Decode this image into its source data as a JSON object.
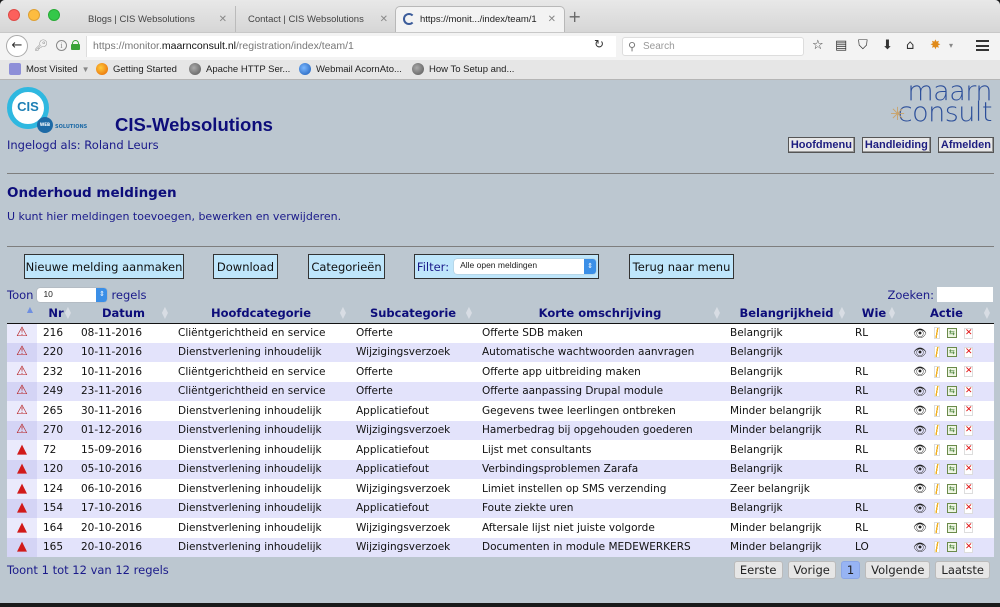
{
  "browser": {
    "tabs": [
      {
        "title": "Blogs | CIS Websolutions",
        "active": false
      },
      {
        "title": "Contact | CIS Websolutions",
        "active": false
      },
      {
        "title": "https://monit.../index/team/1",
        "active": true
      }
    ],
    "url_prefix": "https://monitor.",
    "url_domain": "maarnconsult.nl",
    "url_path": "/registration/index/team/1",
    "search_placeholder": "Search",
    "bookmarks": [
      {
        "label": "Most Visited",
        "icon": "folder-icon"
      },
      {
        "label": "Getting Started",
        "icon": "firefox-icon"
      },
      {
        "label": "Apache HTTP Ser...",
        "icon": "globe-icon"
      },
      {
        "label": "Webmail AcornAto...",
        "icon": "mail-icon"
      },
      {
        "label": "How To Setup and...",
        "icon": "globe-icon"
      }
    ]
  },
  "header": {
    "logo_text": "CIS",
    "logo_web": "WEB",
    "logo_solutions": "SOLUTIONS",
    "site_title": "CIS-Websolutions",
    "logged_in": "Ingelogd als: Roland Leurs",
    "partner_logo_line1": "maarn",
    "partner_logo_line2": "consult",
    "links": [
      "Hoofdmenu",
      "Handleiding",
      "Afmelden"
    ]
  },
  "main": {
    "heading": "Onderhoud meldingen",
    "description": "U kunt hier meldingen toevoegen, bewerken en verwijderen.",
    "buttons": {
      "new": "Nieuwe melding aanmaken",
      "download": "Download",
      "categories": "Categorieën",
      "filter_label": "Filter:",
      "filter_value": "Alle open meldingen",
      "back": "Terug naar menu"
    },
    "length": {
      "prefix": "Toon",
      "value": "10",
      "suffix": "regels"
    },
    "search_label": "Zoeken:",
    "search_value": ""
  },
  "table": {
    "columns": [
      "",
      "Nr",
      "Datum",
      "Hoofdcategorie",
      "Subcategorie",
      "Korte omschrijving",
      "Belangrijkheid",
      "Wie",
      "Actie"
    ],
    "rows": [
      {
        "status": "outline",
        "nr": "216",
        "datum": "08-11-2016",
        "hoofd": "Cliëntgerichtheid en service",
        "sub": "Offerte",
        "omschrijving": "Offerte SDB maken",
        "belang": "Belangrijk",
        "wie": "RL"
      },
      {
        "status": "outline",
        "nr": "220",
        "datum": "10-11-2016",
        "hoofd": "Dienstverlening inhoudelijk",
        "sub": "Wijzigingsverzoek",
        "omschrijving": "Automatische wachtwoorden aanvragen",
        "belang": "Belangrijk",
        "wie": ""
      },
      {
        "status": "outline",
        "nr": "232",
        "datum": "10-11-2016",
        "hoofd": "Cliëntgerichtheid en service",
        "sub": "Offerte",
        "omschrijving": "Offerte app uitbreiding maken",
        "belang": "Belangrijk",
        "wie": "RL"
      },
      {
        "status": "outline",
        "nr": "249",
        "datum": "23-11-2016",
        "hoofd": "Cliëntgerichtheid en service",
        "sub": "Offerte",
        "omschrijving": "Offerte aanpassing Drupal module",
        "belang": "Belangrijk",
        "wie": "RL"
      },
      {
        "status": "outline",
        "nr": "265",
        "datum": "30-11-2016",
        "hoofd": "Dienstverlening inhoudelijk",
        "sub": "Applicatiefout",
        "omschrijving": "Gegevens twee leerlingen ontbreken",
        "belang": "Minder belangrijk",
        "wie": "RL"
      },
      {
        "status": "outline",
        "nr": "270",
        "datum": "01-12-2016",
        "hoofd": "Dienstverlening inhoudelijk",
        "sub": "Wijzigingsverzoek",
        "omschrijving": "Hamerbedrag bij opgehouden goederen",
        "belang": "Minder belangrijk",
        "wie": "RL"
      },
      {
        "status": "filled",
        "nr": "72",
        "datum": "15-09-2016",
        "hoofd": "Dienstverlening inhoudelijk",
        "sub": "Applicatiefout",
        "omschrijving": "Lijst met consultants",
        "belang": "Belangrijk",
        "wie": "RL"
      },
      {
        "status": "filled",
        "nr": "120",
        "datum": "05-10-2016",
        "hoofd": "Dienstverlening inhoudelijk",
        "sub": "Applicatiefout",
        "omschrijving": "Verbindingsproblemen Zarafa",
        "belang": "Belangrijk",
        "wie": "RL"
      },
      {
        "status": "filled",
        "nr": "124",
        "datum": "06-10-2016",
        "hoofd": "Dienstverlening inhoudelijk",
        "sub": "Wijzigingsverzoek",
        "omschrijving": "Limiet instellen op SMS verzending",
        "belang": "Zeer belangrijk",
        "wie": ""
      },
      {
        "status": "filled",
        "nr": "154",
        "datum": "17-10-2016",
        "hoofd": "Dienstverlening inhoudelijk",
        "sub": "Applicatiefout",
        "omschrijving": "Foute ziekte uren",
        "belang": "Belangrijk",
        "wie": "RL"
      },
      {
        "status": "filled",
        "nr": "164",
        "datum": "20-10-2016",
        "hoofd": "Dienstverlening inhoudelijk",
        "sub": "Wijzigingsverzoek",
        "omschrijving": "Aftersale lijst niet juiste volgorde",
        "belang": "Minder belangrijk",
        "wie": "RL"
      },
      {
        "status": "filled",
        "nr": "165",
        "datum": "20-10-2016",
        "hoofd": "Dienstverlening inhoudelijk",
        "sub": "Wijzigingsverzoek",
        "omschrijving": "Documenten in module MEDEWERKERS",
        "belang": "Minder belangrijk",
        "wie": "LO"
      }
    ]
  },
  "footer": {
    "info": "Toont 1 tot 12 van 12 regels",
    "pager": {
      "first": "Eerste",
      "prev": "Vorige",
      "current": "1",
      "next": "Volgende",
      "last": "Laatste"
    }
  },
  "colors": {
    "page_bg": "#bcc7d0",
    "heading": "#0d0d7a",
    "button_bg": "#bfe6fb",
    "row_even": "#e3e3fb",
    "warning_red": "#d11a1a"
  }
}
